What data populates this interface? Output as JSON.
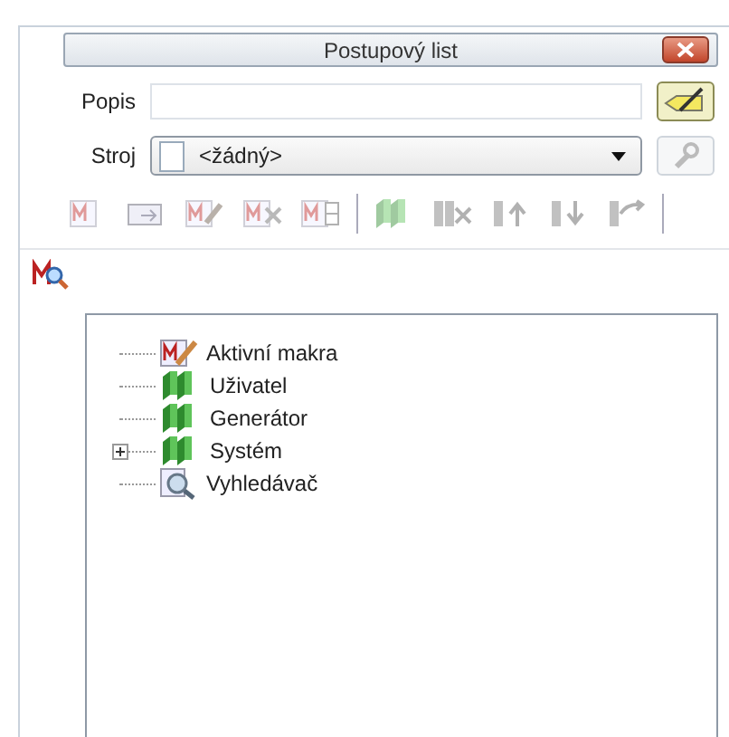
{
  "window": {
    "title": "Postupový list"
  },
  "form": {
    "popis_label": "Popis",
    "stroj_label": "Stroj",
    "stroj_value": "<žádný>"
  },
  "toolbar": [
    {
      "kind": "macro",
      "disabled": true
    },
    {
      "kind": "import",
      "disabled": true
    },
    {
      "kind": "macroedit",
      "disabled": true
    },
    {
      "kind": "macrodelete",
      "disabled": true
    },
    {
      "kind": "macrowindow",
      "disabled": true
    },
    {
      "kind": "separator"
    },
    {
      "kind": "booksadd",
      "disabled": true
    },
    {
      "kind": "booksdelete",
      "disabled": true
    },
    {
      "kind": "booksup",
      "disabled": true
    },
    {
      "kind": "booksdown",
      "disabled": true
    },
    {
      "kind": "booksexport",
      "disabled": true
    },
    {
      "kind": "separator"
    }
  ],
  "tree": [
    {
      "label": "Aktivní makra",
      "kind": "macro"
    },
    {
      "label": "Uživatel",
      "kind": "books"
    },
    {
      "label": "Generátor",
      "kind": "books"
    },
    {
      "label": "Systém",
      "kind": "books",
      "expanded": false
    },
    {
      "label": "Vyhledávač",
      "kind": "finder"
    }
  ]
}
